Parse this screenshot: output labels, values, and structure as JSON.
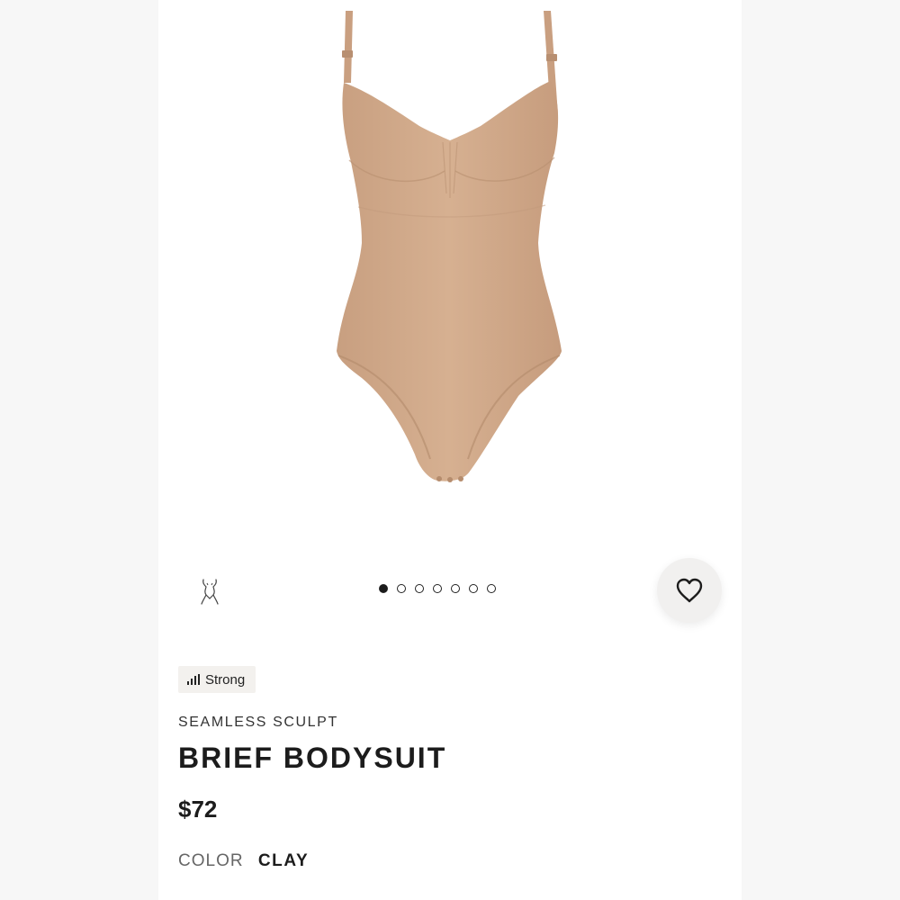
{
  "colors": {
    "background": "#ffffff",
    "garment": "#d1a98a",
    "text_primary": "#1c1c1c",
    "text_muted": "#666666",
    "badge_bg": "#f3f1ee"
  },
  "icons": {
    "fit_guide": "body-silhouette-icon",
    "wishlist": "heart-outline-icon",
    "compression": "signal-bars-icon"
  },
  "carousel": {
    "count": 7,
    "active_index": 0
  },
  "product": {
    "compression_label": "Strong",
    "collection": "SEAMLESS SCULPT",
    "name": "BRIEF BODYSUIT",
    "price": "$72",
    "color_label": "COLOR",
    "color_value": "CLAY"
  }
}
